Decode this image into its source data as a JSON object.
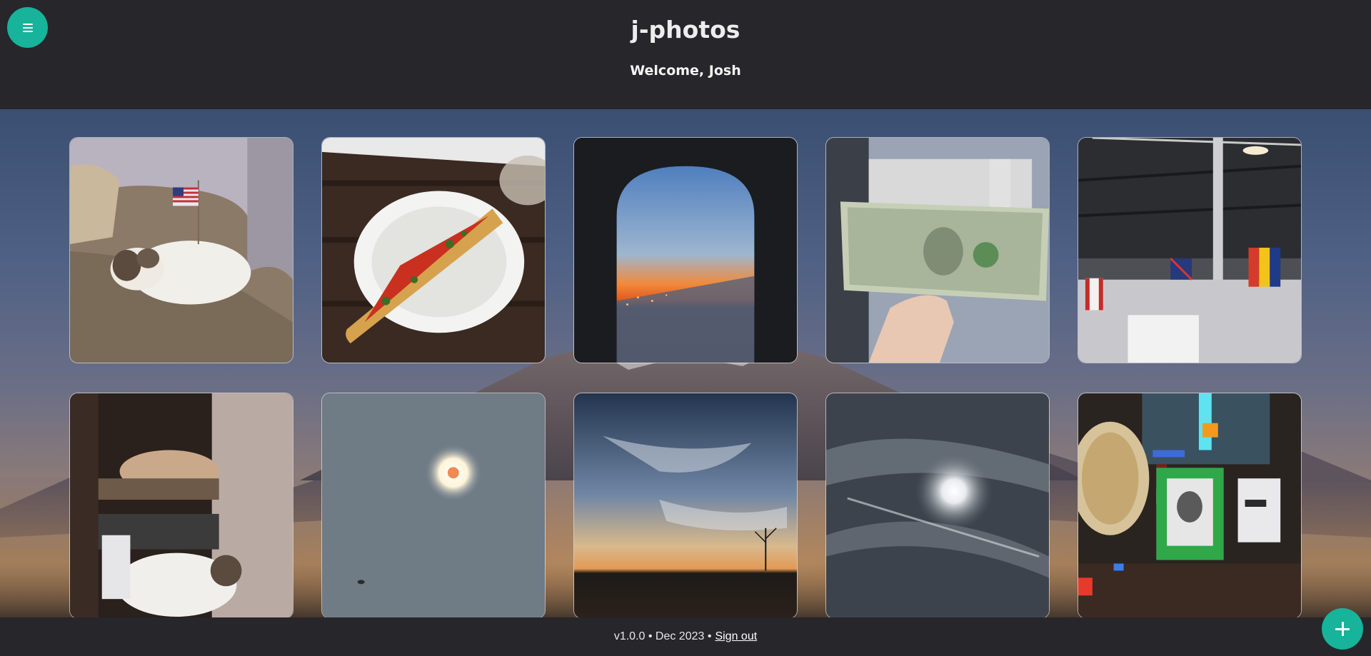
{
  "app": {
    "title": "j-photos",
    "welcome": "Welcome, Josh"
  },
  "menu_button": {
    "icon": "hamburger-menu-icon"
  },
  "add_button": {
    "icon": "plus-icon"
  },
  "footer": {
    "version_text": "v1.0.0 • Dec 2023 • ",
    "sign_out_label": "Sign out"
  },
  "colors": {
    "accent": "#17b39a",
    "header_background": "#26262b"
  },
  "photos": [
    {
      "subject": "dog on couch with american flag"
    },
    {
      "subject": "pizza slice on paper plate"
    },
    {
      "subject": "airplane window sunset over city"
    },
    {
      "subject": "hand holding one dollar bill"
    },
    {
      "subject": "warehouse ceiling with flags"
    },
    {
      "subject": "dogs sleeping in closet"
    },
    {
      "subject": "solar eclipse"
    },
    {
      "subject": "sunset sky over field"
    },
    {
      "subject": "moon behind clouds"
    },
    {
      "subject": "desk with globe and framed portrait"
    }
  ]
}
